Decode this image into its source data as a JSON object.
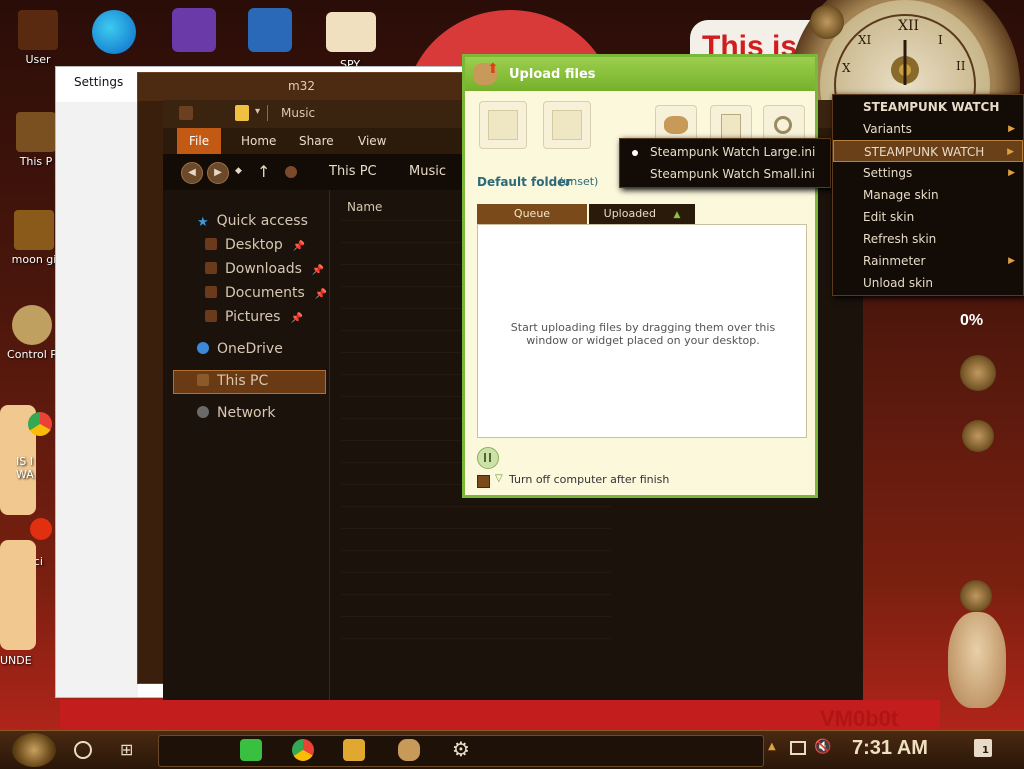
{
  "desktop": {
    "banner_text": "This is",
    "bottom_logo": "VM0b0t",
    "percent_readout": "0%",
    "icons_left": [
      "User",
      "This P",
      "moon gi",
      "Control P",
      "IS I\nWA",
      "laci",
      "UNDE"
    ],
    "icons_top": [
      "SPY"
    ]
  },
  "settings_window": {
    "title": "Settings"
  },
  "explorer_back": {
    "title": "m32"
  },
  "explorer": {
    "title": "Music",
    "ribbon_tabs": [
      "File",
      "Home",
      "Share",
      "View"
    ],
    "breadcrumb": [
      "This PC",
      "Music"
    ],
    "column_name": "Name",
    "nav": {
      "quick_access": "Quick access",
      "desktop": "Desktop",
      "downloads": "Downloads",
      "documents": "Documents",
      "pictures": "Pictures",
      "onedrive": "OneDrive",
      "this_pc": "This PC",
      "network": "Network"
    }
  },
  "upload": {
    "title": "Upload files",
    "default_folder_label": "Default folder",
    "default_folder_value": "(unset)",
    "tab_queue": "Queue",
    "tab_uploaded": "Uploaded",
    "drop_message": "Start uploading files by dragging them over this window or widget placed on your desktop.",
    "shutdown_label": "Turn off computer after finish"
  },
  "context_menu": {
    "header": "STEAMPUNK WATCH",
    "items": [
      "Variants",
      "STEAMPUNK WATCH",
      "Settings",
      "Manage skin",
      "Edit skin",
      "Refresh skin",
      "Rainmeter",
      "Unload skin"
    ]
  },
  "submenu": {
    "items": [
      "Steampunk Watch Large.ini",
      "Steampunk Watch Small.ini"
    ]
  },
  "taskbar": {
    "time": "7:31 AM",
    "notification_count": "1"
  },
  "colors": {
    "accent_green": "#7ab83a",
    "menu_highlight": "#6a4018",
    "ribbon_file": "#c25a14"
  }
}
